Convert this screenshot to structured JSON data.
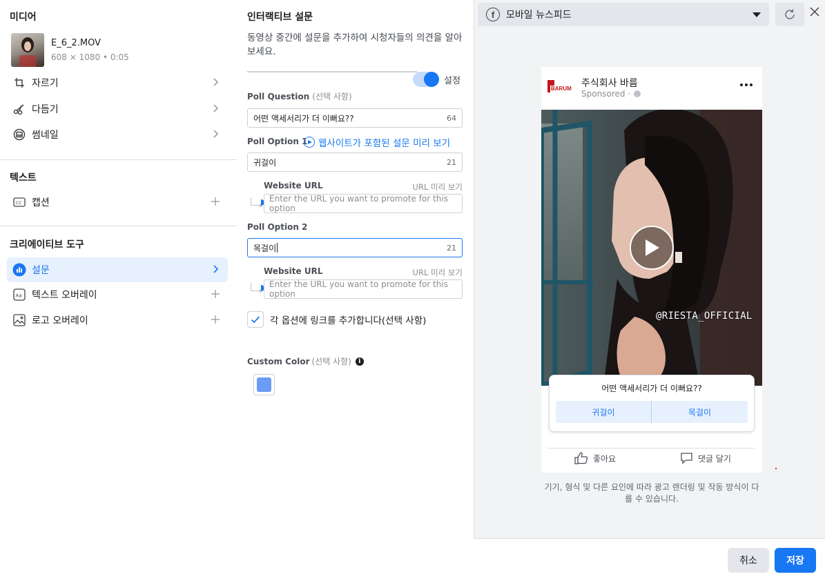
{
  "left": {
    "media_title": "미디어",
    "media_file": "E_6_2.MOV",
    "media_meta": "608 × 1080 • 0:05",
    "media_items": [
      {
        "label": "자르기"
      },
      {
        "label": "다듬기"
      },
      {
        "label": "썸네일"
      }
    ],
    "text_title": "텍스트",
    "text_items": [
      {
        "label": "캡션"
      }
    ],
    "creative_title": "크리에이티브 도구",
    "creative_items": [
      {
        "label": "설문"
      },
      {
        "label": "텍스트 오버레이"
      },
      {
        "label": "로고 오버레이"
      }
    ]
  },
  "middle": {
    "title": "인터랙티브 설문",
    "description": "동영상 중간에 설문을 추가하여 시청자들의 의견을 알아보세요.",
    "toggle_label": "설정",
    "toggle_on": true,
    "poll_question_label": "Poll Question",
    "optional_text": "(선택 사항)",
    "poll_question_value": "어떤 액세서리가 더 이뻐요??",
    "poll_question_count": "64",
    "poll_option1_label": "Poll Option 1",
    "preview_link": "웹사이트가 포함된 설문 미리 보기",
    "poll_option1_value": "귀걸이",
    "poll_option1_count": "21",
    "website_url_label": "Website URL",
    "url_preview_label": "URL 미리 보기",
    "url_placeholder": "Enter the URL you want to promote for this option",
    "poll_option2_label": "Poll Option 2",
    "poll_option2_value": "목걸이",
    "poll_option2_count": "21",
    "checkbox_label": "각 옵션에 링크를 추가합니다(선택 사항)",
    "checkbox_checked": true,
    "custom_color_label": "Custom Color",
    "custom_color_value": "#6b9cf5"
  },
  "preview": {
    "placement": "모바일 뉴스피드",
    "brand_name": "주식회사 바름",
    "brand_logo_text": "BARUM",
    "sponsored": "Sponsored ·",
    "watermark": "@RIESTA_OFFICIAL",
    "poll_question": "어떤 액세서리가 더 이뻐요??",
    "poll_option1": "귀걸이",
    "poll_option2": "목걸이",
    "like_label": "좋아요",
    "comment_label": "댓글 달기",
    "disclaimer": "기기, 형식 및 다른 요인에 따라 광고 렌더링 및 작동 방식이 다를 수 있습니다."
  },
  "footer": {
    "cancel_label": "취소",
    "save_label": "저장"
  },
  "colors": {
    "accent": "#1877f2",
    "brand_red": "#c4161c"
  }
}
